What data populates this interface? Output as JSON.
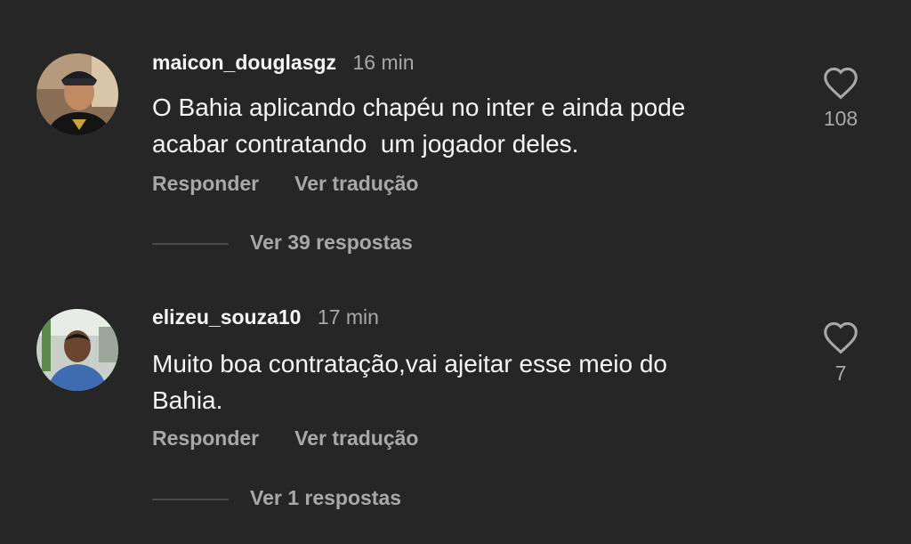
{
  "comments": [
    {
      "username": "maicon_douglasgz",
      "time": "16 min",
      "text": "O Bahia aplicando chapéu no inter e ainda pode\nacabar contratando  um jogador deles.",
      "reply_label": "Responder",
      "translate_label": "Ver tradução",
      "view_replies_label": "Ver 39 respostas",
      "likes": "108",
      "like_icon": "heart-outline-icon"
    },
    {
      "username": "elizeu_souza10",
      "time": "17 min",
      "text": "Muito boa contratação,vai ajeitar esse meio do\nBahia.",
      "reply_label": "Responder",
      "translate_label": "Ver tradução",
      "view_replies_label": "Ver 1 respostas",
      "likes": "7",
      "like_icon": "heart-outline-icon"
    }
  ],
  "colors": {
    "background": "#262626",
    "primary_text": "#f5f5f5",
    "secondary_text": "#a8a8a8"
  }
}
